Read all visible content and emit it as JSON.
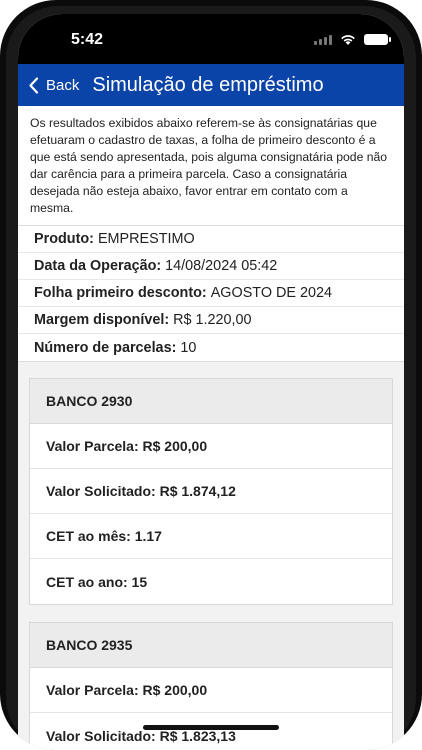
{
  "status": {
    "time": "5:42"
  },
  "nav": {
    "back_label": "Back",
    "title": "Simulação de empréstimo"
  },
  "notice": "Os resultados exibidos abaixo referem-se às consignatárias que efetuaram o cadastro de taxas, a folha de primeiro desconto é a que está sendo apresentada, pois alguma consignatária pode não dar carência para a primeira parcela. Caso a consignatária desejada não esteja abaixo, favor entrar em contato com a mesma.",
  "info": [
    {
      "label": "Produto:",
      "value": "EMPRESTIMO"
    },
    {
      "label": "Data da Operação:",
      "value": "14/08/2024 05:42"
    },
    {
      "label": "Folha primeiro desconto:",
      "value": "AGOSTO DE 2024"
    },
    {
      "label": "Margem disponível:",
      "value": "R$ 1.220,00"
    },
    {
      "label": "Número de parcelas:",
      "value": "10"
    }
  ],
  "banks": [
    {
      "name": "BANCO 2930",
      "rows": [
        "Valor Parcela: R$ 200,00",
        "Valor Solicitado: R$ 1.874,12",
        "CET ao mês: 1.17",
        "CET ao ano: 15"
      ]
    },
    {
      "name": "BANCO 2935",
      "rows": [
        "Valor Parcela: R$ 200,00",
        "Valor Solicitado: R$ 1.823,13"
      ]
    }
  ],
  "colors": {
    "nav_bg": "#0b44a8",
    "results_bg": "#f2f2f2"
  },
  "icons": {
    "back": "chevron-left-icon",
    "wifi": "wifi-icon",
    "battery": "battery-icon",
    "signal": "signal-icon"
  }
}
